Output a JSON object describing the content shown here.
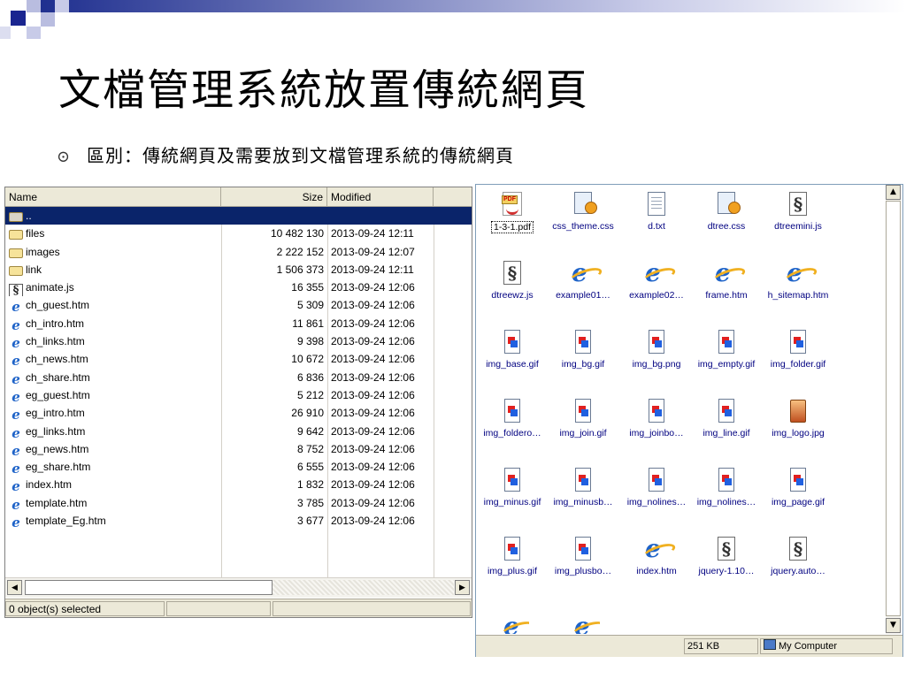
{
  "slide": {
    "title": "文檔管理系統放置傳統網頁",
    "bullet_glyph": "⊙",
    "bullet_text": "區別：傳統網頁及需要放到文檔管理系統的傳統網頁"
  },
  "file_manager": {
    "columns": [
      "Name",
      "Size",
      "Modified"
    ],
    "rows": [
      {
        "name": "..",
        "size": "",
        "modified": "",
        "icon": "folder-up-icon",
        "selected": true
      },
      {
        "name": "files",
        "size": "10 482 130",
        "modified": "2013-09-24 12:11",
        "icon": "folder-icon"
      },
      {
        "name": "images",
        "size": "2 222 152",
        "modified": "2013-09-24 12:07",
        "icon": "folder-icon"
      },
      {
        "name": "link",
        "size": "1 506 373",
        "modified": "2013-09-24 12:11",
        "icon": "folder-icon"
      },
      {
        "name": "animate.js",
        "size": "16 355",
        "modified": "2013-09-24 12:06",
        "icon": "script-icon"
      },
      {
        "name": "ch_guest.htm",
        "size": "5 309",
        "modified": "2013-09-24 12:06",
        "icon": "html-icon"
      },
      {
        "name": "ch_intro.htm",
        "size": "11 861",
        "modified": "2013-09-24 12:06",
        "icon": "html-icon"
      },
      {
        "name": "ch_links.htm",
        "size": "9 398",
        "modified": "2013-09-24 12:06",
        "icon": "html-icon"
      },
      {
        "name": "ch_news.htm",
        "size": "10 672",
        "modified": "2013-09-24 12:06",
        "icon": "html-icon"
      },
      {
        "name": "ch_share.htm",
        "size": "6 836",
        "modified": "2013-09-24 12:06",
        "icon": "html-icon"
      },
      {
        "name": "eg_guest.htm",
        "size": "5 212",
        "modified": "2013-09-24 12:06",
        "icon": "html-icon"
      },
      {
        "name": "eg_intro.htm",
        "size": "26 910",
        "modified": "2013-09-24 12:06",
        "icon": "html-icon"
      },
      {
        "name": "eg_links.htm",
        "size": "9 642",
        "modified": "2013-09-24 12:06",
        "icon": "html-icon"
      },
      {
        "name": "eg_news.htm",
        "size": "8 752",
        "modified": "2013-09-24 12:06",
        "icon": "html-icon"
      },
      {
        "name": "eg_share.htm",
        "size": "6 555",
        "modified": "2013-09-24 12:06",
        "icon": "html-icon"
      },
      {
        "name": "index.htm",
        "size": "1 832",
        "modified": "2013-09-24 12:06",
        "icon": "html-icon"
      },
      {
        "name": "template.htm",
        "size": "3 785",
        "modified": "2013-09-24 12:06",
        "icon": "html-icon"
      },
      {
        "name": "template_Eg.htm",
        "size": "3 677",
        "modified": "2013-09-24 12:06",
        "icon": "html-icon"
      }
    ],
    "status": "0 object(s) selected"
  },
  "icon_view": {
    "items": [
      {
        "label": "1-3-1.pdf",
        "icon": "pdf-icon",
        "focused": true
      },
      {
        "label": "css_theme.css",
        "icon": "css-icon"
      },
      {
        "label": "d.txt",
        "icon": "text-icon"
      },
      {
        "label": "dtree.css",
        "icon": "css-icon"
      },
      {
        "label": "dtreemini.js",
        "icon": "script-icon"
      },
      {
        "label": "dtreewz.js",
        "icon": "script-icon"
      },
      {
        "label": "example01…",
        "icon": "html-icon"
      },
      {
        "label": "example02…",
        "icon": "html-icon"
      },
      {
        "label": "frame.htm",
        "icon": "html-icon"
      },
      {
        "label": "h_sitemap.htm",
        "icon": "html-icon"
      },
      {
        "label": "img_base.gif",
        "icon": "image-icon"
      },
      {
        "label": "img_bg.gif",
        "icon": "image-icon"
      },
      {
        "label": "img_bg.png",
        "icon": "image-icon"
      },
      {
        "label": "img_empty.gif",
        "icon": "image-icon"
      },
      {
        "label": "img_folder.gif",
        "icon": "image-icon"
      },
      {
        "label": "img_foldero…",
        "icon": "image-icon"
      },
      {
        "label": "img_join.gif",
        "icon": "image-icon"
      },
      {
        "label": "img_joinbo…",
        "icon": "image-icon"
      },
      {
        "label": "img_line.gif",
        "icon": "image-icon"
      },
      {
        "label": "img_logo.jpg",
        "icon": "jpg-icon"
      },
      {
        "label": "img_minus.gif",
        "icon": "image-icon"
      },
      {
        "label": "img_minusb…",
        "icon": "image-icon"
      },
      {
        "label": "img_nolines…",
        "icon": "image-icon"
      },
      {
        "label": "img_nolines…",
        "icon": "image-icon"
      },
      {
        "label": "img_page.gif",
        "icon": "image-icon"
      },
      {
        "label": "img_plus.gif",
        "icon": "image-icon"
      },
      {
        "label": "img_plusbo…",
        "icon": "image-icon"
      },
      {
        "label": "index.htm",
        "icon": "html-icon"
      },
      {
        "label": "jquery-1.10…",
        "icon": "script-icon"
      },
      {
        "label": "jquery.auto…",
        "icon": "script-icon"
      }
    ],
    "status_size": "251 KB",
    "status_zone": "My Computer"
  }
}
